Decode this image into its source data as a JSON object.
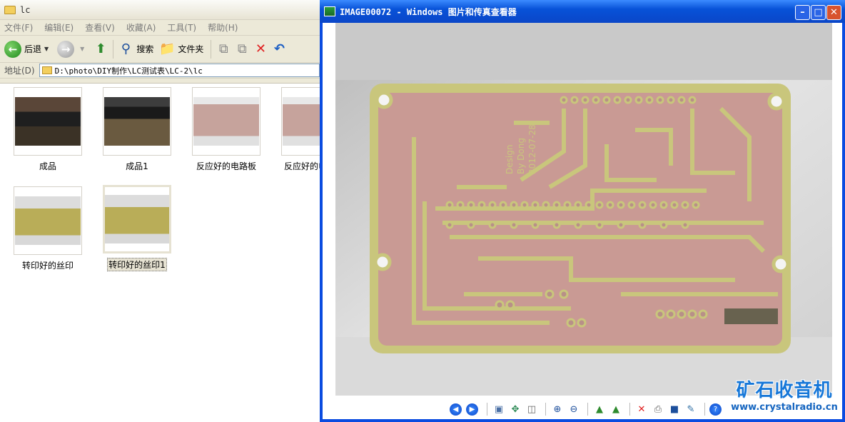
{
  "explorer": {
    "title": "lc",
    "menu": [
      "文件(F)",
      "编辑(E)",
      "查看(V)",
      "收藏(A)",
      "工具(T)",
      "帮助(H)"
    ],
    "toolbar": {
      "back": "后退",
      "search": "搜索",
      "folders": "文件夹"
    },
    "address_label": "地址(D)",
    "address": "D:\\photo\\DIY制作\\LC测试表\\LC-2\\lc",
    "files": [
      {
        "name": "成品"
      },
      {
        "name": "成品1"
      },
      {
        "name": "反应好的电路板"
      },
      {
        "name": "反应好的电"
      },
      {
        "name": "转印好的丝印"
      },
      {
        "name": "转印好的丝印1"
      }
    ]
  },
  "viewer": {
    "title": "IMAGE00072 - Windows 图片和传真查看器",
    "board_text": {
      "line1": "Design",
      "line2": "By Dong",
      "line3": "2012-07-28"
    }
  },
  "watermark": {
    "cn": "矿石收音机",
    "url": "www.crystalradio.cn"
  },
  "icons": [
    "folder-icon",
    "back-icon",
    "forward-icon",
    "up-icon",
    "search-icon",
    "folders-icon",
    "move-icon",
    "copy-icon",
    "delete-icon",
    "undo-icon",
    "prev-icon",
    "next-icon",
    "best-fit-icon",
    "actual-size-icon",
    "slideshow-icon",
    "zoom-in-icon",
    "zoom-out-icon",
    "rotate-cw-icon",
    "rotate-ccw-icon",
    "print-icon",
    "save-icon",
    "open-editor-icon",
    "help-icon"
  ],
  "colors": {
    "title_blue": "#0a46c8",
    "close_red": "#d8532e",
    "board_pink": "#c99a94",
    "board_green": "#c8c47a",
    "watermark_blue": "#1677d8"
  }
}
